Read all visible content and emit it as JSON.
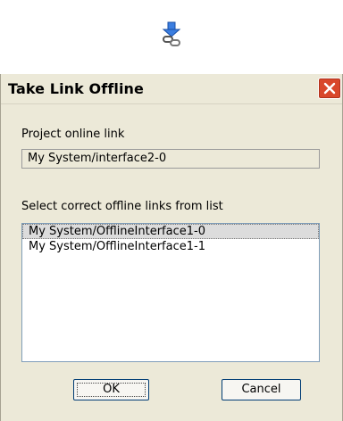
{
  "icon": {
    "name": "link-offline-icon"
  },
  "dialog": {
    "title": "Take Link Offline",
    "close_icon": "close-icon",
    "project_online_link_label": "Project online link",
    "project_online_link_value": "My System/interface2-0",
    "select_label": "Select correct offline links from list",
    "offline_links": [
      "My System/OfflineInterface1-0",
      "My System/OfflineInterface1-1"
    ],
    "selected_index": 0,
    "ok_label": "OK",
    "cancel_label": "Cancel"
  },
  "colors": {
    "dialog_bg": "#ece9d8",
    "close_button": "#d9472b",
    "list_border": "#7f9db9",
    "icon_blue": "#2f6fd6"
  }
}
